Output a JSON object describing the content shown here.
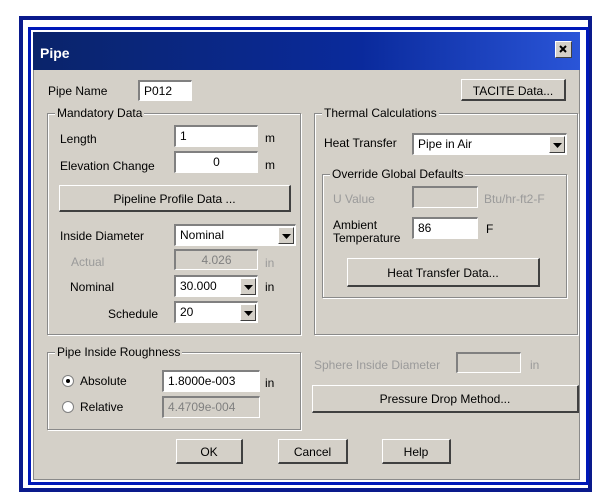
{
  "window": {
    "title": "Pipe"
  },
  "pipe_name": {
    "label": "Pipe Name",
    "value": "P012"
  },
  "tacite_button": "TACITE Data...",
  "mandatory": {
    "title": "Mandatory Data",
    "length_label": "Length",
    "length_value": "1",
    "length_unit": "m",
    "elevation_label": "Elevation Change",
    "elevation_value": "0",
    "elevation_unit": "m",
    "profile_button": "Pipeline Profile Data ...",
    "inside_diameter_label": "Inside Diameter",
    "inside_diameter_option": "Nominal",
    "actual_label": "Actual",
    "actual_value": "4.026",
    "actual_unit": "in",
    "nominal_label": "Nominal",
    "nominal_value": "30.000",
    "nominal_unit": "in",
    "schedule_label": "Schedule",
    "schedule_value": "20"
  },
  "roughness": {
    "title": "Pipe Inside Roughness",
    "absolute_label": "Absolute",
    "absolute_value": "1.8000e-003",
    "absolute_unit": "in",
    "relative_label": "Relative",
    "relative_value": "4.4709e-004",
    "selected": "Absolute"
  },
  "thermal": {
    "title": "Thermal Calculations",
    "heat_transfer_label": "Heat Transfer",
    "heat_transfer_value": "Pipe in Air",
    "override_title": "Override Global Defaults",
    "u_value_label": "U Value",
    "u_value_unit": "Btu/hr-ft2-F",
    "ambient_label_1": "Ambient",
    "ambient_label_2": "Temperature",
    "ambient_value": "86",
    "ambient_unit": "F",
    "heat_transfer_button": "Heat Transfer Data..."
  },
  "sphere": {
    "label": "Sphere Inside Diameter",
    "unit": "in"
  },
  "pressure_drop_button": "Pressure Drop Method...",
  "buttons": {
    "ok": "OK",
    "cancel": "Cancel",
    "help": "Help"
  },
  "colors": {
    "titlebar": "#0a246a",
    "frame": "#0a1a8c",
    "dialog": "#d4d0c8"
  }
}
